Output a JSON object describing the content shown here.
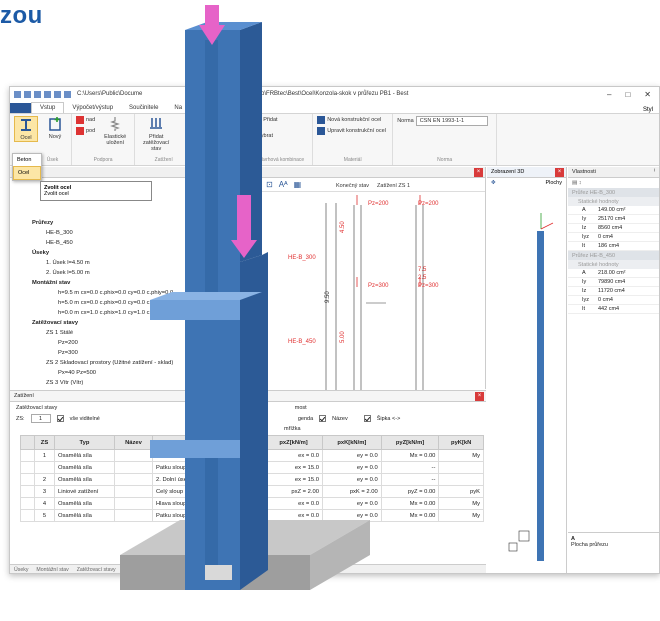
{
  "brand": {
    "text": "zou"
  },
  "window": {
    "path": "C:\\Users\\Public\\Docume",
    "path_tail": "Demo\\FRBtec\\Best\\Ocel\\Konzola-skok v průřezu PB1 - Best",
    "controls": [
      "–",
      "□",
      "✕"
    ]
  },
  "menu": {
    "tabs": [
      "Vstup",
      "Výpočet/výstup",
      "Součinitele",
      "Na",
      "Vzda"
    ],
    "right": "Styl"
  },
  "ribbon": {
    "ocel": "Ocel",
    "novy": "Nový",
    "nad": "nad",
    "pod": "pod",
    "elasticke": "Elastické uložení",
    "pridat_zat": "Přidat zatěžovací stav",
    "pridat": "Přidat",
    "vybrat": "Vybrat",
    "nova_konstr": "Nová konstrukční ocel",
    "upravit_konstr": "Upravit konstrukční ocel",
    "norma_label": "Norma",
    "norma_value": "CSN EN 1993-1-1",
    "groups": [
      "Úsek",
      "Podpora",
      "Zatížení",
      "Návrhová kombinace",
      "Materiál",
      "Norma"
    ]
  },
  "dropdown": {
    "items": [
      "Beton",
      "Ocel"
    ]
  },
  "tooltip": {
    "title": "Zvolit ocel",
    "text": "Zvolit ocel"
  },
  "tree": {
    "items": [
      {
        "level": 1,
        "text": "Průřezy"
      },
      {
        "level": 2,
        "text": "HE-B_300"
      },
      {
        "level": 2,
        "text": "HE-B_450"
      },
      {
        "level": 1,
        "text": "Úseky"
      },
      {
        "level": 2,
        "text": "1. Úsek  l=4.50 m"
      },
      {
        "level": 2,
        "text": "2. Úsek  l=5.00 m"
      },
      {
        "level": 1,
        "text": "Montážní stav"
      },
      {
        "level": 3,
        "text": "h=9.5 m  cx=0.0 c.phix=0.0 cy=0.0 c.phiy=0.0"
      },
      {
        "level": 3,
        "text": "h=5.0 m  cx=0.0 c.phix=0.0 cy=0.0 c.phiy=0.0"
      },
      {
        "level": 3,
        "text": "h=0.0 m  cx=1.0 c.phix=1.0 cy=1.0 c.phiy=1.0"
      },
      {
        "level": 1,
        "text": "Zatěžovací stavy"
      },
      {
        "level": 2,
        "text": "ZS 1 Stálé"
      },
      {
        "level": 3,
        "text": "Pz=200"
      },
      {
        "level": 3,
        "text": "Pz=300"
      },
      {
        "level": 2,
        "text": "ZS 2 Skladovací prostory (Užitné zatížení - sklad)"
      },
      {
        "level": 3,
        "text": "Px=40 Pz=500"
      },
      {
        "level": 2,
        "text": "ZS 3 Vítr (Vítr)"
      }
    ]
  },
  "mid": {
    "title": "Konečný stav",
    "load_state": "Zatížení ZS 1",
    "labels": [
      "Pz=200",
      "Pz=200",
      "Pz=300",
      "Pz=300",
      "HE-B_300",
      "HE-B_450",
      "4.50",
      "9.50",
      "5.00",
      "7.5",
      "2.5"
    ]
  },
  "panel3d": {
    "title": "Zobrazení 3D",
    "mode": "Plochy"
  },
  "props": {
    "title": "Vlastnosti",
    "sections": [
      {
        "name": "Průřez HE-B_300",
        "sub": "Statické hodnoty",
        "rows": [
          [
            "A",
            "149.00 cm²"
          ],
          [
            "Iy",
            "25170 cm4"
          ],
          [
            "Iz",
            "8560 cm4"
          ],
          [
            "Iyz",
            "0 cm4"
          ],
          [
            "It",
            "186 cm4"
          ]
        ]
      },
      {
        "name": "Průřez HE-B_450",
        "sub": "Statické hodnoty",
        "rows": [
          [
            "A",
            "218.00 cm²"
          ],
          [
            "Iy",
            "79890 cm4"
          ],
          [
            "Iz",
            "11720 cm4"
          ],
          [
            "Iyz",
            "0 cm4"
          ],
          [
            "It",
            "442 cm4"
          ]
        ]
      }
    ],
    "foot_key": "A",
    "foot_text": "Plocha průřezu"
  },
  "bottom": {
    "title": "Zatížení",
    "states_label": "Zatěžovací stavy",
    "zs_label": "ZS:",
    "zs_value": "1",
    "all_visible": "vše viditelné",
    "zat_label": "Zatí",
    "most": "most",
    "legenda": "genda",
    "nazev": "Název",
    "sipka": "Šipka <->",
    "mrizka": "mřížka",
    "columns": [
      "",
      "ZS",
      "Typ",
      "Název",
      "Vztažené",
      "Délka[m]",
      "pxZ[kN/m]",
      "pxK[kN/m]",
      "pyZ[kN/m]",
      "pyK[kN"
    ],
    "header_hint": [
      "P[kN]",
      "ex[cm]",
      "ey[cm]",
      "M[kNm]",
      "My[kN"
    ],
    "rows": [
      [
        "1",
        "Osamělá síla",
        "",
        "Hlava sloupu",
        "Pz = 200.00",
        "ex = 0.0",
        "ey = 0.0",
        "Mx = 0.00",
        "My"
      ],
      [
        "",
        "Osamělá síla",
        "",
        "Patku sloupu",
        "Pz = 300.00",
        "ex = 15.0",
        "ey = 0.0",
        "--",
        ""
      ],
      [
        "2",
        "Osamělá síla",
        "",
        "2. Dolní úsek",
        "Pz = 500.00",
        "ex = 15.0",
        "ey = 0.0",
        "--",
        ""
      ],
      [
        "3",
        "Liniové zatížení",
        "",
        "Celý sloup",
        "l = 0.000",
        "pxZ = 2.00",
        "pxK = 2.00",
        "pyZ = 0.00",
        "pyK"
      ],
      [
        "4",
        "Osamělá síla",
        "",
        "Hlava sloupu",
        "Pz = 80.00",
        "ex = 0.0",
        "ey = 0.0",
        "Mx = 0.00",
        "My"
      ],
      [
        "5",
        "Osamělá síla",
        "",
        "Patku sloupu",
        "Pz = 0.00",
        "ex = 0.0",
        "ey = 0.0",
        "Mx = 0.00",
        "My"
      ]
    ],
    "status": [
      "Úseky",
      "Montážní stav",
      "Zatěžovací stavy",
      "Zat"
    ]
  },
  "colors": {
    "brand": "#1c5aa6",
    "accent": "#2b5797",
    "column_blue": "#3e74b4",
    "arrow_pink": "#e663c8",
    "load_red": "#e03030"
  }
}
